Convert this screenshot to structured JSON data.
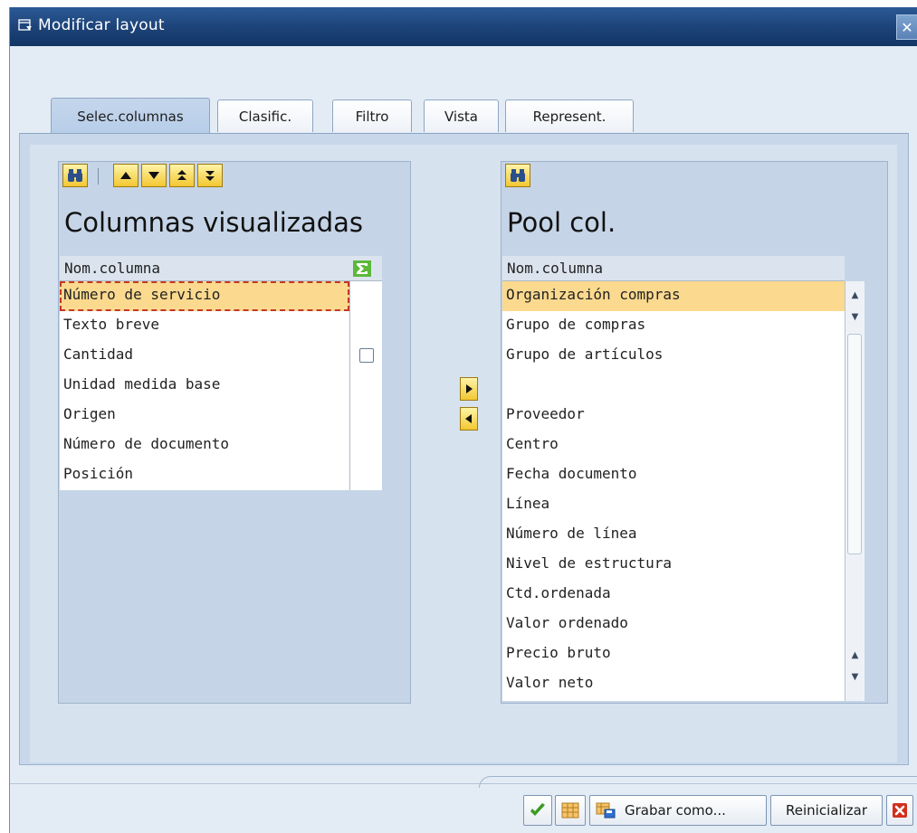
{
  "window": {
    "title": "Modificar layout",
    "close_symbol": "✕"
  },
  "tabs": [
    {
      "label": "Selec.columnas",
      "active": true
    },
    {
      "label": "Clasific.",
      "active": false
    },
    {
      "label": "Filtro",
      "active": false
    },
    {
      "label": "Vista",
      "active": false
    },
    {
      "label": "Represent.",
      "active": false
    }
  ],
  "left_pane": {
    "title": "Columnas visualizadas",
    "column_header": "Nom.columna",
    "rows": [
      "Número de servicio",
      "Texto breve",
      "Cantidad",
      "Unidad medida base",
      "Origen",
      "Número de documento",
      "Posición"
    ],
    "selected_row": 0,
    "checkbox_row": 2
  },
  "right_pane": {
    "title": "Pool col.",
    "column_header": "Nom.columna",
    "rows": [
      "Organización compras",
      "Grupo de compras",
      "Grupo de artículos",
      "",
      "Proveedor",
      "Centro",
      "Fecha documento",
      "Línea",
      "Número de línea",
      "Nivel de estructura",
      "Ctd.ordenada",
      "Valor ordenado",
      "Precio bruto",
      "Valor neto"
    ],
    "selected_row": 0
  },
  "icons": {
    "find": "binoculars-icon",
    "sum": "sigma-icon",
    "up": "move-up-icon",
    "down": "move-down-icon",
    "top": "move-top-icon",
    "bottom": "move-bottom-icon"
  },
  "footer": {
    "save_as_label": "Grabar como...",
    "reset_label": "Reinicializar"
  },
  "colors": {
    "title_bar": "#1c4277",
    "selected_row": "#fbd98f",
    "button_yellow": "#f2c732",
    "pane_bg": "#c5d5e7",
    "accept_green": "#3c9b1f",
    "cancel_red": "#d32f1d"
  }
}
